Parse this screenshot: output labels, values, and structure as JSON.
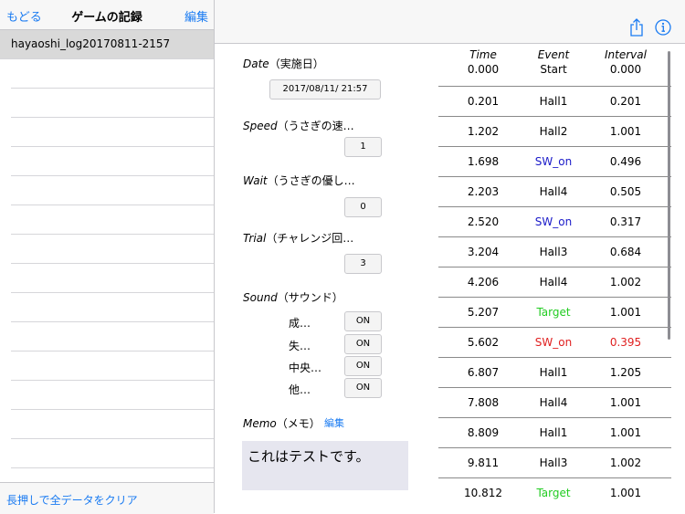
{
  "sidebar": {
    "back_label": "もどる",
    "title": "ゲームの記録",
    "edit_label": "編集",
    "selected_item": "hayaoshi_log20170811-2157",
    "clear_label": "長押しで全データをクリア"
  },
  "toolbar": {
    "share_icon": "share-icon",
    "info_icon": "info-icon"
  },
  "form": {
    "date": {
      "label_en": "Date",
      "label_ja": "（実施日）",
      "value": "2017/08/11/ 21:57"
    },
    "speed": {
      "label_en": "Speed",
      "label_ja": "（うさぎの速…",
      "value": "1"
    },
    "wait": {
      "label_en": "Wait",
      "label_ja": "（うさぎの優し…",
      "value": "0"
    },
    "trial": {
      "label_en": "Trial",
      "label_ja": "（チャレンジ回…",
      "value": "3"
    },
    "sound": {
      "label_en": "Sound",
      "label_ja": "（サウンド）",
      "items": [
        {
          "label": "成…",
          "value": "ON"
        },
        {
          "label": "失…",
          "value": "ON"
        },
        {
          "label": "中央…",
          "value": "ON"
        },
        {
          "label": "他…",
          "value": "ON"
        }
      ]
    },
    "memo": {
      "label_en": "Memo",
      "label_ja": "（メモ）",
      "edit_label": "編集",
      "text": "これはテストです。"
    }
  },
  "log": {
    "headers": {
      "time": "Time",
      "event": "Event",
      "interval": "Interval"
    },
    "first_row": {
      "time": "0.000",
      "event": "Start",
      "interval": "0.000"
    },
    "rows": [
      {
        "time": "0.201",
        "event": "Hall1",
        "interval": "0.201",
        "event_color": "#000000",
        "interval_color": "#000000"
      },
      {
        "time": "1.202",
        "event": "Hall2",
        "interval": "1.001",
        "event_color": "#000000",
        "interval_color": "#000000"
      },
      {
        "time": "1.698",
        "event": "SW_on",
        "interval": "0.496",
        "event_color": "#1a1ac8",
        "interval_color": "#000000"
      },
      {
        "time": "2.203",
        "event": "Hall4",
        "interval": "0.505",
        "event_color": "#000000",
        "interval_color": "#000000"
      },
      {
        "time": "2.520",
        "event": "SW_on",
        "interval": "0.317",
        "event_color": "#1a1ac8",
        "interval_color": "#000000"
      },
      {
        "time": "3.204",
        "event": "Hall3",
        "interval": "0.684",
        "event_color": "#000000",
        "interval_color": "#000000"
      },
      {
        "time": "4.206",
        "event": "Hall4",
        "interval": "1.002",
        "event_color": "#000000",
        "interval_color": "#000000"
      },
      {
        "time": "5.207",
        "event": "Target",
        "interval": "1.001",
        "event_color": "#22cc22",
        "interval_color": "#000000"
      },
      {
        "time": "5.602",
        "event": "SW_on",
        "interval": "0.395",
        "event_color": "#e02020",
        "interval_color": "#e02020"
      },
      {
        "time": "6.807",
        "event": "Hall1",
        "interval": "1.205",
        "event_color": "#000000",
        "interval_color": "#000000"
      },
      {
        "time": "7.808",
        "event": "Hall4",
        "interval": "1.001",
        "event_color": "#000000",
        "interval_color": "#000000"
      },
      {
        "time": "8.809",
        "event": "Hall1",
        "interval": "1.001",
        "event_color": "#000000",
        "interval_color": "#000000"
      },
      {
        "time": "9.811",
        "event": "Hall3",
        "interval": "1.002",
        "event_color": "#000000",
        "interval_color": "#000000"
      },
      {
        "time": "10.812",
        "event": "Target",
        "interval": "1.001",
        "event_color": "#22cc22",
        "interval_color": "#000000"
      }
    ]
  },
  "colors": {
    "accent": "#1a7bf2"
  }
}
